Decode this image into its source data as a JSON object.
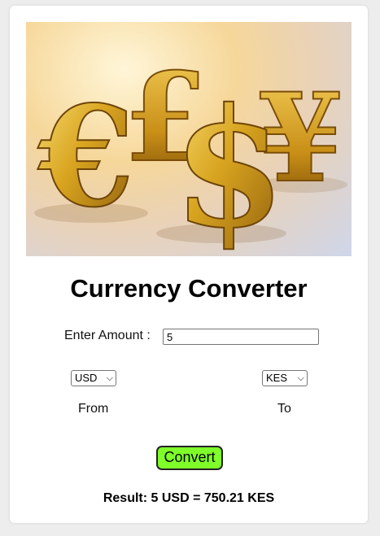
{
  "hero": {
    "image_label": "currency-symbols-image",
    "symbols": [
      "€",
      "£",
      "$",
      "¥"
    ],
    "color_gold": "#d4a017"
  },
  "converter": {
    "title": "Currency Converter",
    "amount_label": "Enter Amount :",
    "amount_value": "5",
    "from_currency": "USD",
    "to_currency": "KES",
    "from_label": "From",
    "to_label": "To",
    "convert_label": "Convert",
    "result_text": "Result: 5 USD = 750.21 KES",
    "button_color": "#7fff2a"
  }
}
